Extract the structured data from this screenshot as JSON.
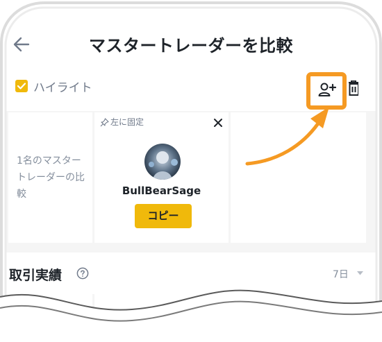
{
  "header": {
    "title": "マスタートレーダーを比較",
    "back_icon": "arrow-left-icon"
  },
  "toolbar": {
    "highlight_label": "ハイライト",
    "highlight_checked": true,
    "add_trader_icon": "add-user-icon",
    "delete_icon": "trash-icon"
  },
  "compare": {
    "count_label": "1名のマスタートレーダーの比較",
    "pin_label": "左に固定",
    "trader_name": "BullBearSage",
    "copy_label": "コピー"
  },
  "performance": {
    "title": "取引実績",
    "period": "7日"
  },
  "colors": {
    "accent": "#f0b90b",
    "highlight_box": "#f59a23",
    "text_primary": "#1e2329",
    "text_secondary": "#848e9c"
  }
}
